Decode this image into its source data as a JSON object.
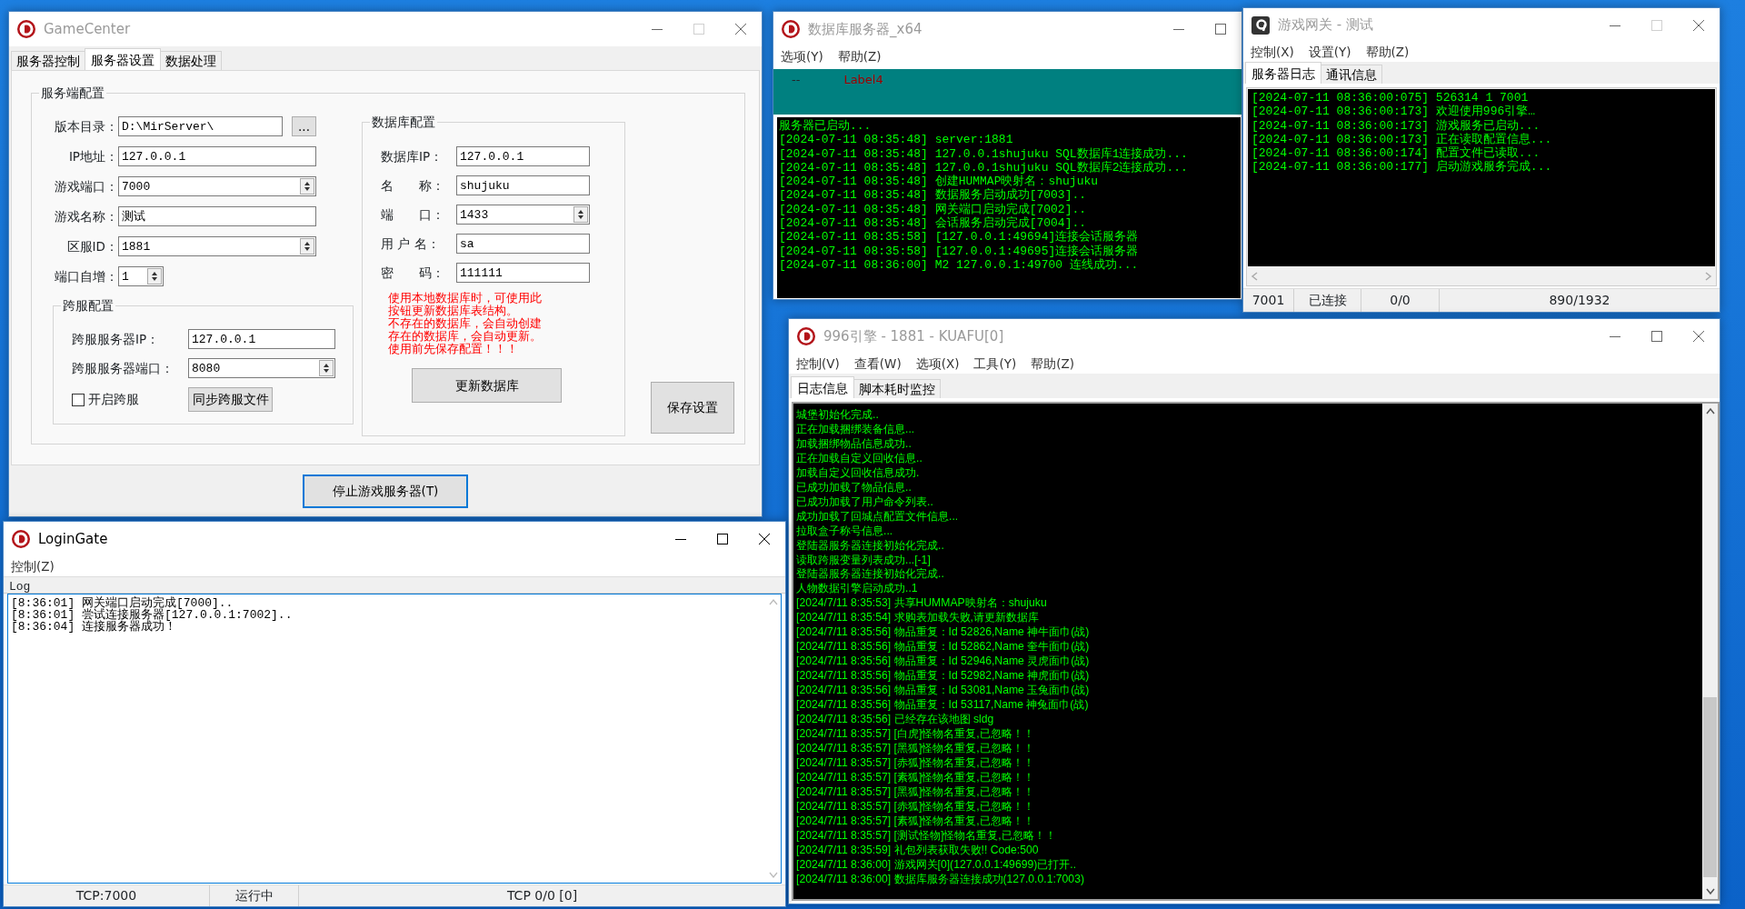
{
  "game_center": {
    "title": "GameCenter",
    "active": false,
    "maximize_enabled": false,
    "tabs": [
      {
        "label": "服务器控制",
        "selected": false
      },
      {
        "label": "服务器设置",
        "selected": true
      },
      {
        "label": "数据处理",
        "selected": false
      }
    ],
    "server_group": {
      "title": "服务端配置",
      "fields": [
        {
          "kind": "browse",
          "label": "版本目录：",
          "value": "D:\\MirServer\\",
          "button": "..."
        },
        {
          "kind": "text",
          "label": "IP地址：",
          "value": "127.0.0.1"
        },
        {
          "kind": "spin",
          "label": "游戏端口：",
          "value": "7000"
        },
        {
          "kind": "text",
          "label": "游戏名称：",
          "value": "测试"
        },
        {
          "kind": "spin",
          "label": "区服ID：",
          "value": "1881"
        },
        {
          "kind": "spin_small",
          "label": "端口自增：",
          "value": "1"
        }
      ]
    },
    "cross_group": {
      "title": "跨服配置",
      "fields": [
        {
          "kind": "text",
          "label": "跨服服务器IP：",
          "value": "127.0.0.1"
        },
        {
          "kind": "spin",
          "label": "跨服服务器端口：",
          "value": "8080"
        }
      ],
      "checkbox": {
        "label": "开启跨服",
        "checked": false
      },
      "button": "同步跨服文件"
    },
    "db_group": {
      "title": "数据库配置",
      "fields": [
        {
          "kind": "text",
          "label": "数据库IP：",
          "value": "127.0.0.1"
        },
        {
          "kind": "text",
          "label": "名　　称：",
          "value": "shujuku"
        },
        {
          "kind": "spin",
          "label": "端　　口：",
          "value": "1433"
        },
        {
          "kind": "text",
          "label": "用 户 名：",
          "value": "sa"
        },
        {
          "kind": "text",
          "label": "密　　码：",
          "value": "111111"
        }
      ],
      "note": [
        "使用本地数据库时，可使用此",
        "按钮更新数据库表结构。",
        "不存在的数据库，会自动创建",
        "存在的数据库，会自动更新。",
        "使用前先保存配置！！！"
      ],
      "button": "更新数据库"
    },
    "save_button": "保存设置",
    "stop_button": "停止游戏服务器(T)"
  },
  "db_server": {
    "title": "数据库服务器_x64",
    "active": false,
    "maximize_enabled": true,
    "menu": [
      "选项(Y)",
      "帮助(Z)"
    ],
    "panel": {
      "dash": "--",
      "label": "Label4"
    },
    "log": [
      "服务器已启动...",
      "[2024-07-11 08:35:48] server:1881",
      "[2024-07-11 08:35:48] 127.0.0.1shujuku SQL数据库1连接成功...",
      "[2024-07-11 08:35:48] 127.0.0.1shujuku SQL数据库2连接成功...",
      "[2024-07-11 08:35:48] 创建HUMMAP映射名：shujuku",
      "[2024-07-11 08:35:48] 数据服务启动成功[7003]..",
      "[2024-07-11 08:35:48] 网关端口启动完成[7002]..",
      "[2024-07-11 08:35:48] 会话服务启动完成[7004]..",
      "[2024-07-11 08:35:58] [127.0.0.1:49694]连接会话服务器",
      "[2024-07-11 08:35:58] [127.0.0.1:49695]连接会话服务器",
      "[2024-07-11 08:36:00] M2 127.0.0.1:49700 连线成功..."
    ]
  },
  "game_gateway": {
    "title": "游戏网关 - 测试",
    "active": false,
    "maximize_enabled": false,
    "menu": [
      "控制(X)",
      "设置(Y)",
      "帮助(Z)"
    ],
    "tabs": [
      {
        "label": "服务器日志",
        "selected": true
      },
      {
        "label": "通讯信息",
        "selected": false
      }
    ],
    "log": [
      "[2024-07-11 08:36:00:075] 526314 1 7001",
      "[2024-07-11 08:36:00:173] 欢迎使用996引擎…",
      "[2024-07-11 08:36:00:173] 游戏服务已启动...",
      "[2024-07-11 08:36:00:173] 正在读取配置信息...",
      "[2024-07-11 08:36:00:174] 配置文件已读取...",
      "[2024-07-11 08:36:00:177] 启动游戏服务完成..."
    ],
    "status": [
      "7001",
      "已连接",
      "0/0",
      "890/1932"
    ]
  },
  "engine": {
    "title": "996引擎 - 1881 - KUAFU[0]",
    "active": false,
    "maximize_enabled": true,
    "menu": [
      "控制(V)",
      "查看(W)",
      "选项(X)",
      "工具(Y)",
      "帮助(Z)"
    ],
    "tabs": [
      {
        "label": "日志信息",
        "selected": true
      },
      {
        "label": "脚本耗时监控",
        "selected": false
      }
    ],
    "log": [
      "城堡初始化完成..",
      "正在加载捆绑装备信息...",
      "加载捆绑物品信息成功..",
      "正在加载自定义回收信息..",
      "加载自定义回收信息成功.",
      "已成功加载了物品信息..",
      "已成功加载了用户命令列表..",
      "成功加载了回城点配置文件信息...",
      "拉取盒子称号信息...",
      "登陆器服务器连接初始化完成..",
      "读取跨服变量列表成功...[-1]",
      "登陆器服务器连接初始化完成..",
      "人物数据引擎启动成功..1",
      "[2024/7/11 8:35:53] 共享HUMMAP映射名：shujuku",
      "[2024/7/11 8:35:54] 求购表加载失败,请更新数据库",
      "[2024/7/11 8:35:56] 物品重复：Id 52826,Name 神牛面巾(战)",
      "[2024/7/11 8:35:56] 物品重复：Id 52862,Name 奎牛面巾(战)",
      "[2024/7/11 8:35:56] 物品重复：Id 52946,Name 灵虎面巾(战)",
      "[2024/7/11 8:35:56] 物品重复：Id 52982,Name 神虎面巾(战)",
      "[2024/7/11 8:35:56] 物品重复：Id 53081,Name 玉兔面巾(战)",
      "[2024/7/11 8:35:56] 物品重复：Id 53117,Name 神兔面巾(战)",
      "[2024/7/11 8:35:56] 已经存在该地图 sldg",
      "[2024/7/11 8:35:57] [白虎]怪物名重复,已忽略！！",
      "[2024/7/11 8:35:57] [黑狐]怪物名重复,已忽略！！",
      "[2024/7/11 8:35:57] [赤狐]怪物名重复,已忽略！！",
      "[2024/7/11 8:35:57] [素狐]怪物名重复,已忽略！！",
      "[2024/7/11 8:35:57] [黑狐]怪物名重复,已忽略！！",
      "[2024/7/11 8:35:57] [赤狐]怪物名重复,已忽略！！",
      "[2024/7/11 8:35:57] [素狐]怪物名重复,已忽略！！",
      "[2024/7/11 8:35:57] [测试怪物]怪物名重复,已忽略！！",
      "[2024/7/11 8:35:59] 礼包列表获取失败!! Code:500",
      "[2024/7/11 8:36:00] 游戏网关[0](127.0.0.1:49699)已打开..",
      "[2024/7/11 8:36:00] 数据库服务器连接成功(127.0.0.1:7003)"
    ]
  },
  "login_gate": {
    "title": "LoginGate",
    "active": true,
    "maximize_enabled": true,
    "menu": [
      "控制(Z)"
    ],
    "log_label": "Log",
    "log": [
      "[8:36:01] 网关端口启动完成[7000]..",
      "[8:36:01] 尝试连接服务器[127.0.0.1:7002]..",
      "[8:36:04] 连接服务器成功！"
    ],
    "status": [
      "TCP:7000",
      "运行中",
      "TCP 0/0 [0]"
    ]
  }
}
